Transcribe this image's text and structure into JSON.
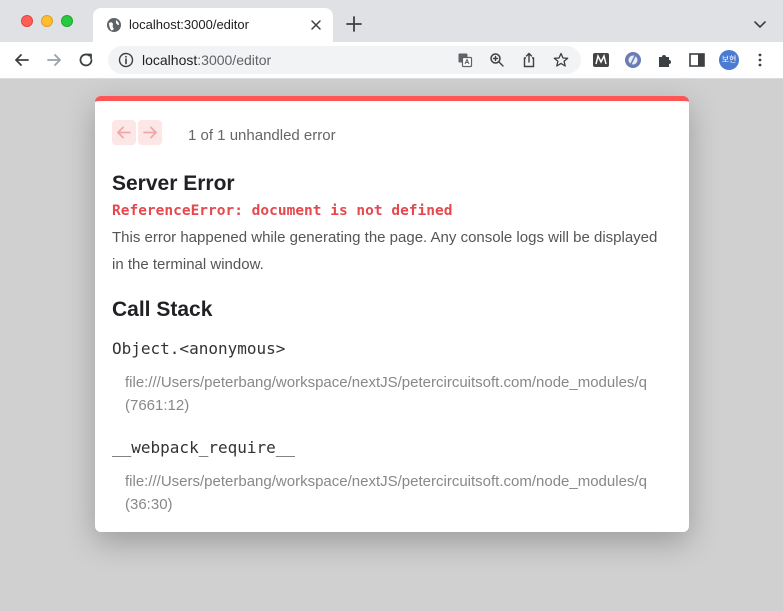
{
  "browser": {
    "tab_title": "localhost:3000/editor",
    "url_host": "localhost",
    "url_rest": ":3000/editor",
    "profile_initials": "보현"
  },
  "overlay": {
    "error_count": "1 of 1 unhandled error",
    "title": "Server Error",
    "message": "ReferenceError: document is not defined",
    "description": "This error happened while generating the page. Any console logs will be displayed in the terminal window.",
    "call_stack_title": "Call Stack",
    "frames": [
      {
        "name": "Object.<anonymous>",
        "file": "file:///Users/peterbang/workspace/nextJS/petercircuitsoft.com/node_modules/q",
        "location": "(7661:12)"
      },
      {
        "name": "__webpack_require__",
        "file": "file:///Users/peterbang/workspace/nextJS/petercircuitsoft.com/node_modules/q",
        "location": "(36:30)"
      }
    ]
  },
  "colors": {
    "accent": "#ff5555",
    "error_text": "#e5484d",
    "backdrop": "#d0d0d0"
  }
}
